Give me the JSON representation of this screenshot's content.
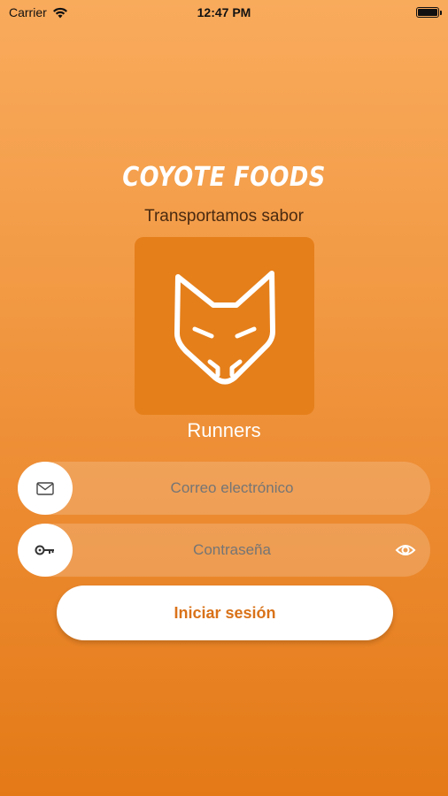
{
  "status_bar": {
    "carrier": "Carrier",
    "time": "12:47 PM",
    "wifi_icon": "wifi-icon",
    "battery_icon": "battery-icon"
  },
  "brand": {
    "name": "COYOTE FOODS",
    "tagline": "Transportamos sabor",
    "logo_icon": "coyote-head-icon",
    "role": "Runners"
  },
  "form": {
    "email": {
      "icon": "envelope-icon",
      "value": "",
      "placeholder": "Correo electrónico"
    },
    "password": {
      "icon": "key-icon",
      "value": "",
      "placeholder": "Contraseña",
      "toggle_icon": "eye-icon"
    },
    "submit_label": "Iniciar sesión"
  },
  "colors": {
    "gradient_top": "#f9ab5c",
    "gradient_bottom": "#e47a17",
    "logo_bg": "#e57f1a",
    "button_text": "#d97219"
  }
}
